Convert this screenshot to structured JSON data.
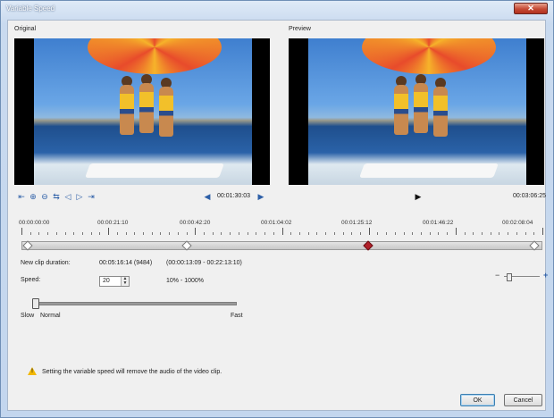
{
  "window": {
    "title": "Variable Speed",
    "close_glyph": "✕"
  },
  "original": {
    "label": "Original",
    "timecode": "00:01:30:03",
    "buttons": [
      "jump-start-icon",
      "add-keyframe-icon",
      "remove-keyframe-icon",
      "reverse-keyframe-icon",
      "prev-keyframe-icon",
      "next-keyframe-icon",
      "end-keyframe-icon"
    ]
  },
  "preview": {
    "label": "Preview",
    "timecode": "00:03:06:25",
    "play_glyph": "▶"
  },
  "ruler": {
    "labels": [
      "00:00:00:00",
      "00:00:21:10",
      "00:00:42:20",
      "00:01:04:02",
      "00:01:25:12",
      "00:01:46:22",
      "00:02:08:04"
    ]
  },
  "details": {
    "new_clip_duration_label": "New clip duration:",
    "new_clip_duration_value": "00:05:16:14 (9484)",
    "range_value": "(00:00:13:09 - 00:22:13:10)",
    "speed_label": "Speed:",
    "speed_value": "20",
    "speed_range": "10% - 1000%",
    "slow_label": "Slow",
    "normal_label": "Normal",
    "fast_label": "Fast"
  },
  "zoom": {
    "minus": "−",
    "plus": "+"
  },
  "warning": {
    "icon_glyph": "!",
    "text": "Setting the variable speed will remove the audio of the video clip."
  },
  "buttons": {
    "ok": "OK",
    "cancel": "Cancel"
  },
  "colors": {
    "accent": "#2d5fa7",
    "keyframe_active": "#b0202a",
    "warning": "#f2b700"
  }
}
